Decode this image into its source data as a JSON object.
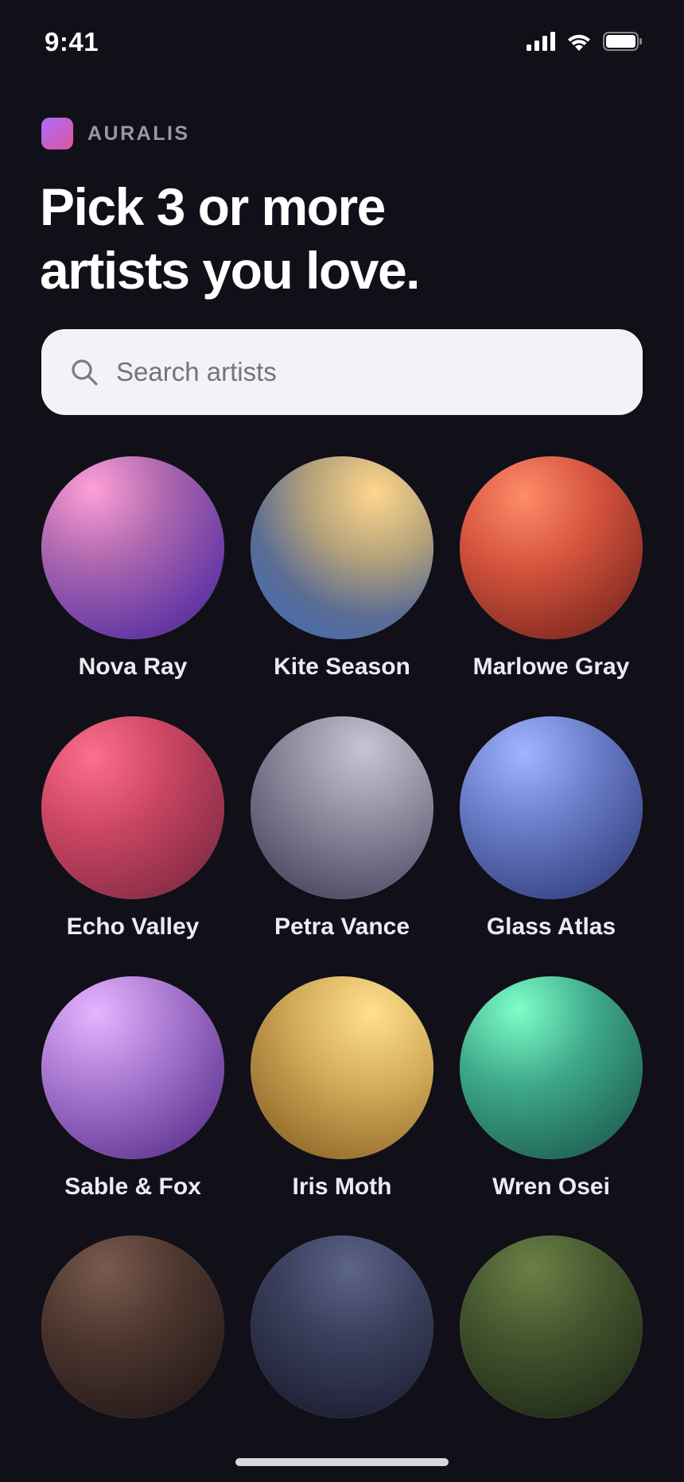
{
  "status_bar": {
    "time": "9:41"
  },
  "brand": {
    "name": "AURALIS"
  },
  "page": {
    "title_line1": "Pick 3 or more",
    "title_line2": "artists you love."
  },
  "search": {
    "placeholder": "Search artists",
    "value": ""
  },
  "artists": [
    {
      "name": "Nova Ray"
    },
    {
      "name": "Kite Season"
    },
    {
      "name": "Marlowe Gray"
    },
    {
      "name": "Echo Valley"
    },
    {
      "name": "Petra Vance"
    },
    {
      "name": "Glass Atlas"
    },
    {
      "name": "Sable & Fox"
    },
    {
      "name": "Iris Moth"
    },
    {
      "name": "Wren Osei"
    },
    {
      "name": ""
    },
    {
      "name": ""
    },
    {
      "name": ""
    }
  ],
  "icons": {
    "signal": "signal-icon",
    "wifi": "wifi-icon",
    "battery": "battery-icon",
    "search": "search-icon",
    "brand_logo": "auralis-logo"
  }
}
